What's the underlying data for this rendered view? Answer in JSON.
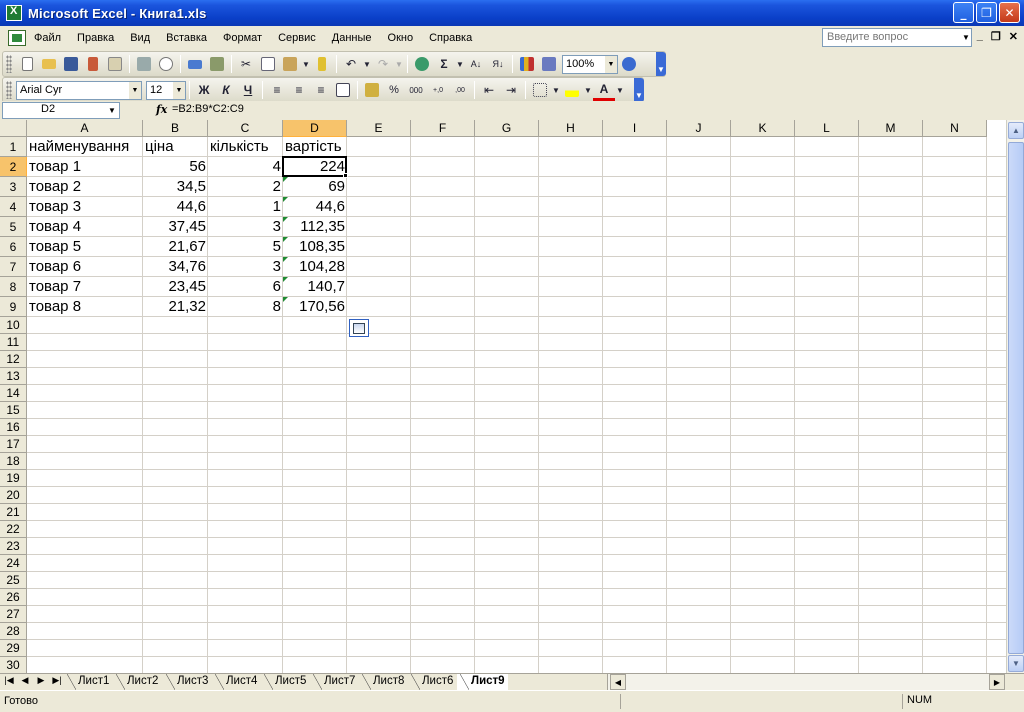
{
  "window": {
    "title": "Microsoft Excel - Книга1.xls"
  },
  "menu": [
    "Файл",
    "Правка",
    "Вид",
    "Вставка",
    "Формат",
    "Сервис",
    "Данные",
    "Окно",
    "Справка"
  ],
  "help_placeholder": "Введите вопрос",
  "toolbar": {
    "zoom": "100%"
  },
  "format_toolbar": {
    "font": "Arial Cyr",
    "size": "12",
    "bold": "Ж",
    "italic": "К",
    "underline": "Ч"
  },
  "formula_bar": {
    "name_box": "D2",
    "fx": "fx",
    "formula": "=B2:B9*C2:C9"
  },
  "columns": [
    "A",
    "B",
    "C",
    "D",
    "E",
    "F",
    "G",
    "H",
    "I",
    "J",
    "K",
    "L",
    "M",
    "N"
  ],
  "selected_column": "D",
  "selected_row": 2,
  "rows": [
    [
      "найменування",
      "ціна",
      "кількість",
      "вартість"
    ],
    [
      "товар 1",
      "56",
      "4",
      "224"
    ],
    [
      "товар 2",
      "34,5",
      "2",
      "69"
    ],
    [
      "товар 3",
      "44,6",
      "1",
      "44,6"
    ],
    [
      "товар 4",
      "37,45",
      "3",
      "112,35"
    ],
    [
      "товар 5",
      "21,67",
      "5",
      "108,35"
    ],
    [
      "товар 6",
      "34,76",
      "3",
      "104,28"
    ],
    [
      "товар 7",
      "23,45",
      "6",
      "140,7"
    ],
    [
      "товар 8",
      "21,32",
      "8",
      "170,56"
    ]
  ],
  "row_count": 30,
  "sheets": [
    "Лист1",
    "Лист2",
    "Лист3",
    "Лист4",
    "Лист5",
    "Лист7",
    "Лист8",
    "Лист6",
    "Лист9"
  ],
  "active_sheet": "Лист9",
  "status": {
    "ready": "Готово",
    "num": "NUM"
  }
}
